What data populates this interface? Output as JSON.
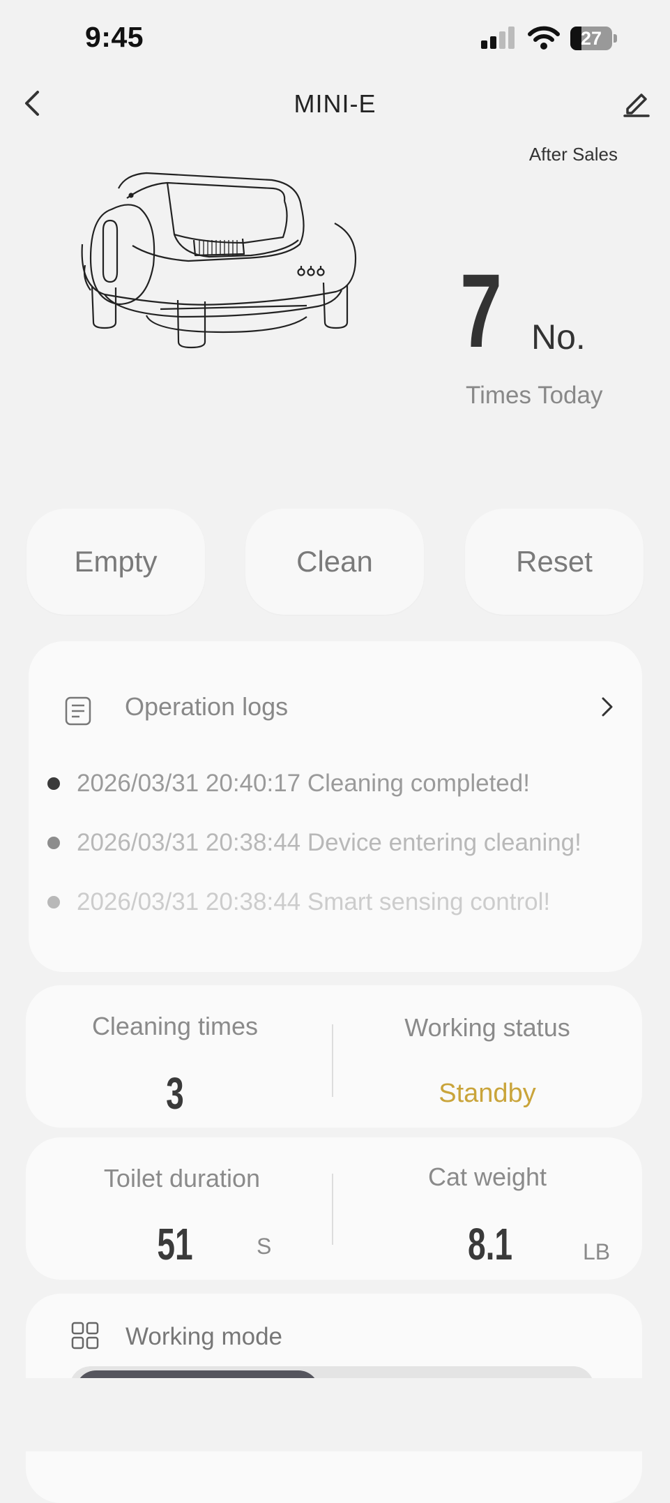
{
  "status_bar": {
    "time": "9:45",
    "battery_level": "27",
    "battery_fraction": 0.27
  },
  "header": {
    "title": "MINI-E",
    "after_sales": "After Sales"
  },
  "summary": {
    "count": "7",
    "unit": "No.",
    "label": "Times Today"
  },
  "actions": [
    {
      "label": "Empty"
    },
    {
      "label": "Clean"
    },
    {
      "label": "Reset"
    }
  ],
  "logs": {
    "title": "Operation logs",
    "items": [
      {
        "text": "2026/03/31 20:40:17 Cleaning completed!",
        "dot_color": "#3a3a3a",
        "text_color": "#9a9a9a"
      },
      {
        "text": "2026/03/31 20:38:44 Device entering cleaning!",
        "dot_color": "#8d8d8d",
        "text_color": "#b8b8b8"
      },
      {
        "text": "2026/03/31 20:38:44 Smart sensing control!",
        "dot_color": "#b8b8b8",
        "text_color": "#cccccc"
      }
    ]
  },
  "stats": {
    "cleaning_times_label": "Cleaning times",
    "cleaning_times_value": "3",
    "working_status_label": "Working status",
    "working_status_value": "Standby",
    "toilet_duration_label": "Toilet duration",
    "toilet_duration_value": "51",
    "toilet_duration_unit": "S",
    "cat_weight_label": "Cat weight",
    "cat_weight_value": "8.1",
    "cat_weight_unit": "LB"
  },
  "mode": {
    "title": "Working mode"
  },
  "colors": {
    "background": "#f2f2f2",
    "card": "#fafafa",
    "accent_status": "#c9a43a",
    "mode_active": "#55555d"
  }
}
